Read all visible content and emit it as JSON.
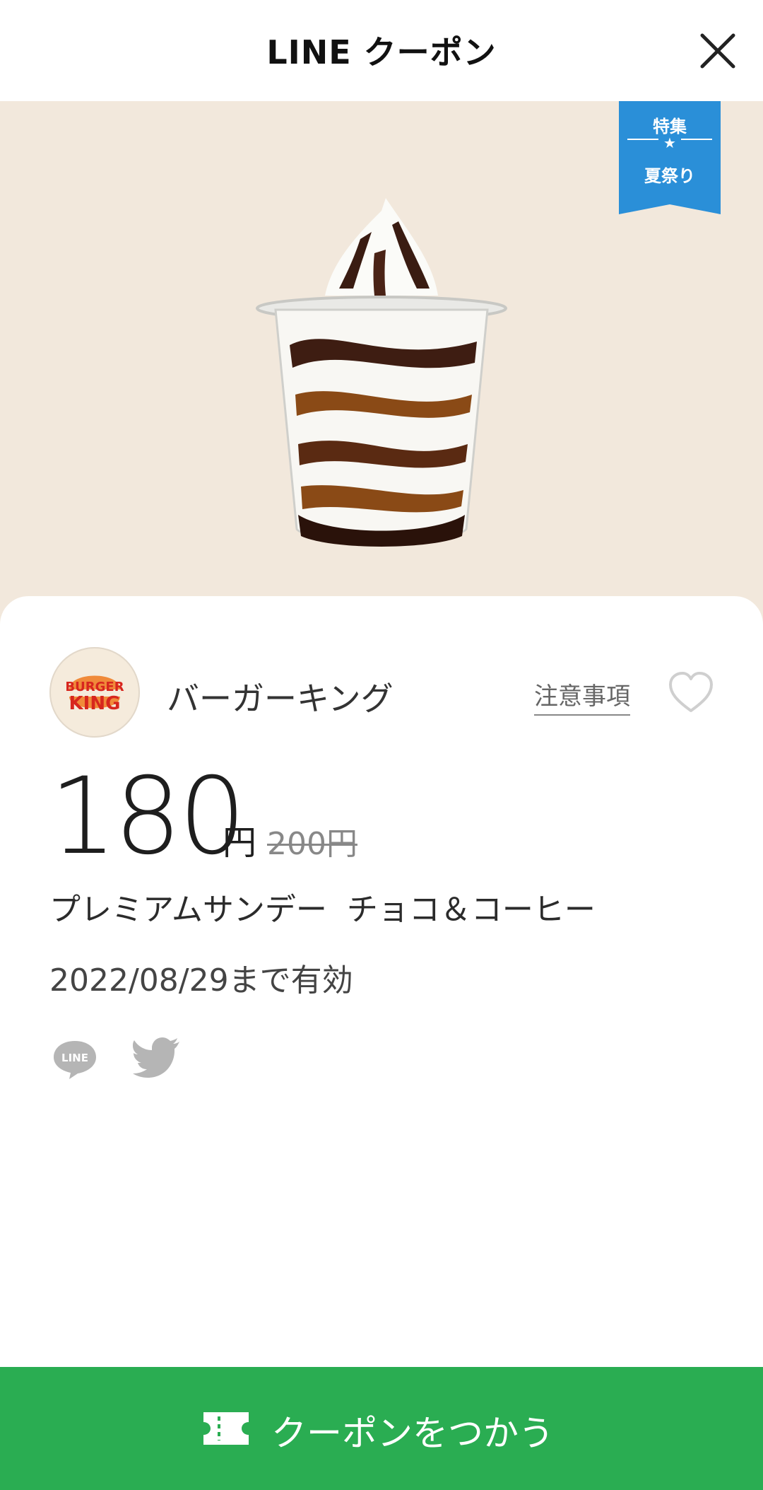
{
  "header": {
    "title": "LINE クーポン",
    "close_icon": "close-icon"
  },
  "hero": {
    "ribbon": {
      "top_text": "特集",
      "star": "★",
      "bottom_text": "夏祭り",
      "color": "#2a8fd8"
    },
    "background_color": "#f2e8dc",
    "image": "sundae-chocolate-coffee-image"
  },
  "coupon": {
    "brand": {
      "logo_text_1": "BURGER",
      "logo_text_2": "KING",
      "name": "バーガーキング"
    },
    "notice_label": "注意事項",
    "favorite_icon": "heart-outline-icon",
    "price": "180",
    "price_unit": "円",
    "original_price": "200円",
    "product_name": "プレミアムサンデー  チョコ＆コーヒー",
    "valid_until": "2022/08/29まで有効",
    "share": {
      "line_icon": "line-share-icon",
      "line_icon_text": "LINE",
      "twitter_icon": "twitter-share-icon"
    }
  },
  "footer": {
    "use_button_label": "クーポンをつかう",
    "button_color": "#2aad52",
    "ticket_icon": "ticket-icon"
  }
}
